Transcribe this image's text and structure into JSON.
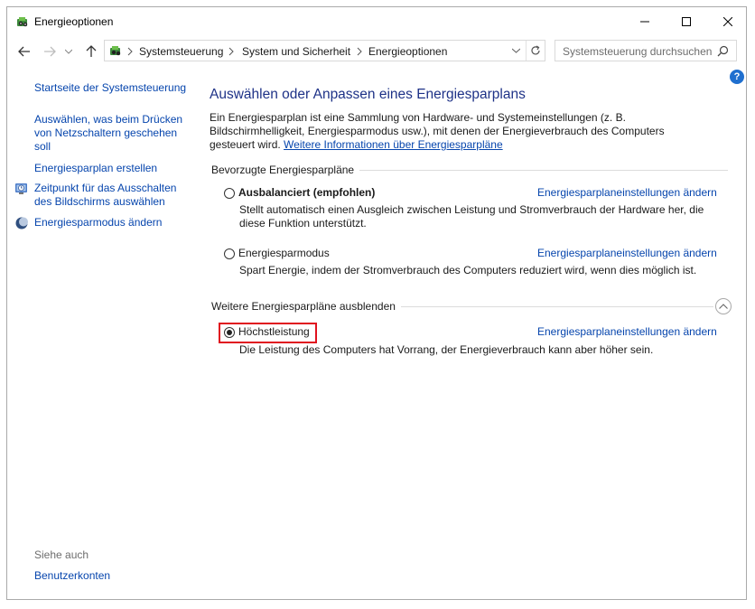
{
  "window": {
    "title": "Energieoptionen"
  },
  "address": {
    "crumbs": [
      "Systemsteuerung",
      "System und Sicherheit",
      "Energieoptionen"
    ],
    "search_placeholder": "Systemsteuerung durchsuchen"
  },
  "help_label": "?",
  "sidebar": {
    "items": [
      {
        "label": "Startseite der Systemsteuerung"
      },
      {
        "label": "Auswählen, was beim Drücken von Netzschaltern geschehen soll"
      },
      {
        "label": "Energiesparplan erstellen"
      },
      {
        "label": "Zeitpunkt für das Ausschalten des Bildschirms auswählen"
      },
      {
        "label": "Energiesparmodus ändern"
      }
    ],
    "see_also_label": "Siehe auch",
    "see_also_items": [
      {
        "label": "Benutzerkonten"
      }
    ]
  },
  "main": {
    "heading": "Auswählen oder Anpassen eines Energiesparplans",
    "intro": "Ein Energiesparplan ist eine Sammlung von Hardware- und Systemeinstellungen (z. B. Bildschirmhelligkeit, Energiesparmodus usw.), mit denen der Energieverbrauch des Computers gesteuert wird.",
    "intro_link": "Weitere Informationen über Energiesparpläne",
    "preferred_label": "Bevorzugte Energiesparpläne",
    "hidden_label": "Weitere Energiesparpläne ausblenden",
    "plans": [
      {
        "name": "Ausbalanciert (empfohlen)",
        "selected": false,
        "desc": "Stellt automatisch einen Ausgleich zwischen Leistung und Stromverbrauch der Hardware her, die diese Funktion unterstützt.",
        "link": "Energiesparplaneinstellungen ändern"
      },
      {
        "name": "Energiesparmodus",
        "selected": false,
        "desc": "Spart Energie, indem der Stromverbrauch des Computers reduziert wird, wenn dies möglich ist.",
        "link": "Energiesparplaneinstellungen ändern"
      },
      {
        "name": "Höchstleistung",
        "selected": true,
        "desc": "Die Leistung des Computers hat Vorrang, der Energieverbrauch kann aber höher sein.",
        "link": "Energiesparplaneinstellungen ändern"
      }
    ]
  },
  "colors": {
    "accent_heading": "#1e3287",
    "link": "#0645ad",
    "highlight": "#e0121f"
  }
}
